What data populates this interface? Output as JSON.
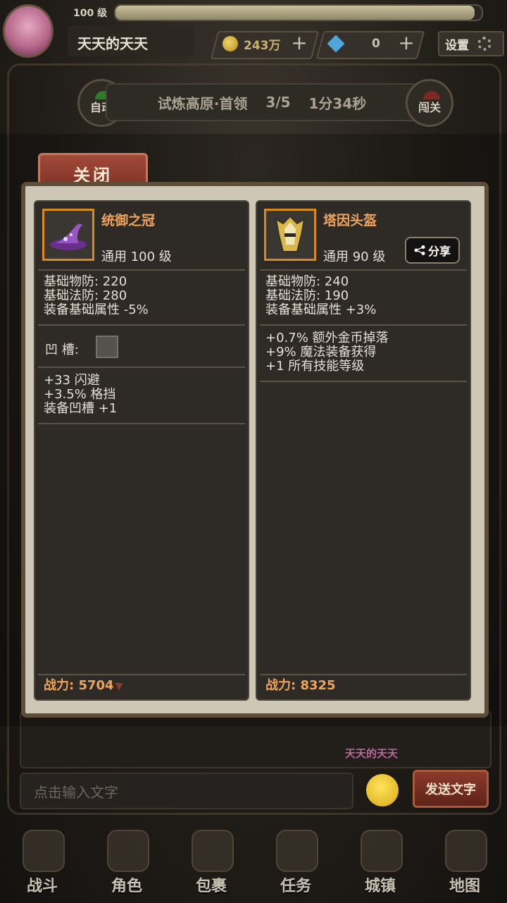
{
  "topbar": {
    "level": "100 级",
    "xp_progress": 0.98,
    "player_name": "天天的天天",
    "gold": "243万",
    "diamonds": "0",
    "settings_label": "设置"
  },
  "stage": {
    "auto_label": "自动",
    "name": "试炼高原·首领",
    "progress": "3/5",
    "time": "1分34秒",
    "challenge_label": "闯关"
  },
  "dialog": {
    "close_label": "关闭",
    "left_item": {
      "name": "统御之冠",
      "type_level": "通用  100 级",
      "base_stats": [
        "基础物防:  220",
        "基础法防:  280",
        "装备基础属性 -5%"
      ],
      "slot_label": "凹   槽:",
      "extra_stats": [
        "+33 闪避",
        "+3.5% 格挡",
        "装备凹槽 +1"
      ],
      "power": "战力:  5704",
      "icon": "purple-wizard-hat-icon"
    },
    "right_item": {
      "name": "塔因头盔",
      "type_level": "通用  90 级",
      "share_label": "分享",
      "base_stats": [
        "基础物防:  240",
        "基础法防:  190",
        "装备基础属性 +3%"
      ],
      "extra_stats": [
        "+0.7% 额外金币掉落",
        "+9% 魔法装备获得",
        "+1 所有技能等级"
      ],
      "power": "战力:  8325",
      "icon": "golden-helmet-icon"
    }
  },
  "chat": {
    "sender": "天天的天天",
    "input_placeholder": "点击输入文字",
    "send_label": "发送文字"
  },
  "nav": [
    "战斗",
    "角色",
    "包裹",
    "任务",
    "城镇",
    "地图"
  ],
  "colors": {
    "accent_orange": "#f0a35a",
    "close_red": "#8b3a2c",
    "panel_bg": "#2e2b27"
  }
}
